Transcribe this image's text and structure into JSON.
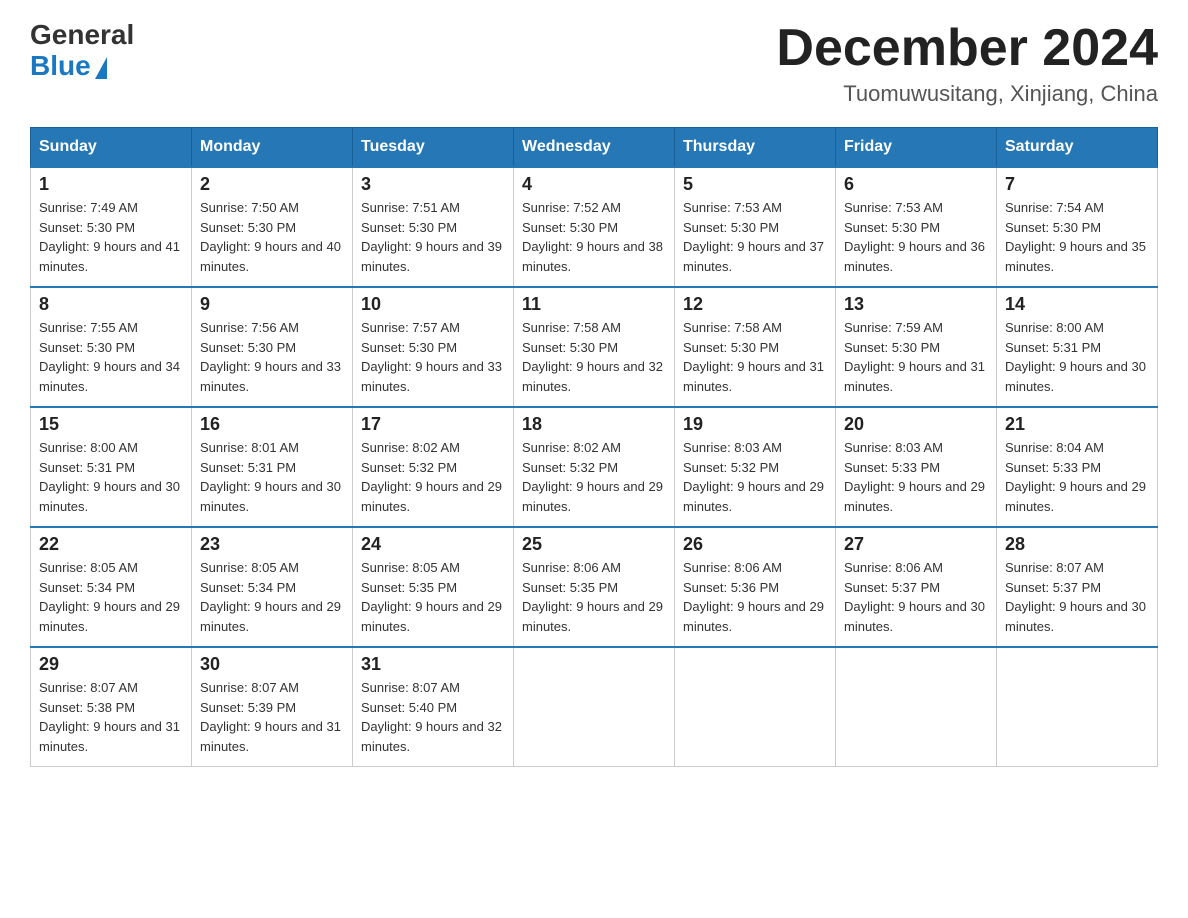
{
  "logo": {
    "general": "General",
    "blue": "Blue"
  },
  "header": {
    "title": "December 2024",
    "location": "Tuomuwusitang, Xinjiang, China"
  },
  "weekdays": [
    "Sunday",
    "Monday",
    "Tuesday",
    "Wednesday",
    "Thursday",
    "Friday",
    "Saturday"
  ],
  "weeks": [
    [
      {
        "day": "1",
        "sunrise": "7:49 AM",
        "sunset": "5:30 PM",
        "daylight": "9 hours and 41 minutes."
      },
      {
        "day": "2",
        "sunrise": "7:50 AM",
        "sunset": "5:30 PM",
        "daylight": "9 hours and 40 minutes."
      },
      {
        "day": "3",
        "sunrise": "7:51 AM",
        "sunset": "5:30 PM",
        "daylight": "9 hours and 39 minutes."
      },
      {
        "day": "4",
        "sunrise": "7:52 AM",
        "sunset": "5:30 PM",
        "daylight": "9 hours and 38 minutes."
      },
      {
        "day": "5",
        "sunrise": "7:53 AM",
        "sunset": "5:30 PM",
        "daylight": "9 hours and 37 minutes."
      },
      {
        "day": "6",
        "sunrise": "7:53 AM",
        "sunset": "5:30 PM",
        "daylight": "9 hours and 36 minutes."
      },
      {
        "day": "7",
        "sunrise": "7:54 AM",
        "sunset": "5:30 PM",
        "daylight": "9 hours and 35 minutes."
      }
    ],
    [
      {
        "day": "8",
        "sunrise": "7:55 AM",
        "sunset": "5:30 PM",
        "daylight": "9 hours and 34 minutes."
      },
      {
        "day": "9",
        "sunrise": "7:56 AM",
        "sunset": "5:30 PM",
        "daylight": "9 hours and 33 minutes."
      },
      {
        "day": "10",
        "sunrise": "7:57 AM",
        "sunset": "5:30 PM",
        "daylight": "9 hours and 33 minutes."
      },
      {
        "day": "11",
        "sunrise": "7:58 AM",
        "sunset": "5:30 PM",
        "daylight": "9 hours and 32 minutes."
      },
      {
        "day": "12",
        "sunrise": "7:58 AM",
        "sunset": "5:30 PM",
        "daylight": "9 hours and 31 minutes."
      },
      {
        "day": "13",
        "sunrise": "7:59 AM",
        "sunset": "5:30 PM",
        "daylight": "9 hours and 31 minutes."
      },
      {
        "day": "14",
        "sunrise": "8:00 AM",
        "sunset": "5:31 PM",
        "daylight": "9 hours and 30 minutes."
      }
    ],
    [
      {
        "day": "15",
        "sunrise": "8:00 AM",
        "sunset": "5:31 PM",
        "daylight": "9 hours and 30 minutes."
      },
      {
        "day": "16",
        "sunrise": "8:01 AM",
        "sunset": "5:31 PM",
        "daylight": "9 hours and 30 minutes."
      },
      {
        "day": "17",
        "sunrise": "8:02 AM",
        "sunset": "5:32 PM",
        "daylight": "9 hours and 29 minutes."
      },
      {
        "day": "18",
        "sunrise": "8:02 AM",
        "sunset": "5:32 PM",
        "daylight": "9 hours and 29 minutes."
      },
      {
        "day": "19",
        "sunrise": "8:03 AM",
        "sunset": "5:32 PM",
        "daylight": "9 hours and 29 minutes."
      },
      {
        "day": "20",
        "sunrise": "8:03 AM",
        "sunset": "5:33 PM",
        "daylight": "9 hours and 29 minutes."
      },
      {
        "day": "21",
        "sunrise": "8:04 AM",
        "sunset": "5:33 PM",
        "daylight": "9 hours and 29 minutes."
      }
    ],
    [
      {
        "day": "22",
        "sunrise": "8:05 AM",
        "sunset": "5:34 PM",
        "daylight": "9 hours and 29 minutes."
      },
      {
        "day": "23",
        "sunrise": "8:05 AM",
        "sunset": "5:34 PM",
        "daylight": "9 hours and 29 minutes."
      },
      {
        "day": "24",
        "sunrise": "8:05 AM",
        "sunset": "5:35 PM",
        "daylight": "9 hours and 29 minutes."
      },
      {
        "day": "25",
        "sunrise": "8:06 AM",
        "sunset": "5:35 PM",
        "daylight": "9 hours and 29 minutes."
      },
      {
        "day": "26",
        "sunrise": "8:06 AM",
        "sunset": "5:36 PM",
        "daylight": "9 hours and 29 minutes."
      },
      {
        "day": "27",
        "sunrise": "8:06 AM",
        "sunset": "5:37 PM",
        "daylight": "9 hours and 30 minutes."
      },
      {
        "day": "28",
        "sunrise": "8:07 AM",
        "sunset": "5:37 PM",
        "daylight": "9 hours and 30 minutes."
      }
    ],
    [
      {
        "day": "29",
        "sunrise": "8:07 AM",
        "sunset": "5:38 PM",
        "daylight": "9 hours and 31 minutes."
      },
      {
        "day": "30",
        "sunrise": "8:07 AM",
        "sunset": "5:39 PM",
        "daylight": "9 hours and 31 minutes."
      },
      {
        "day": "31",
        "sunrise": "8:07 AM",
        "sunset": "5:40 PM",
        "daylight": "9 hours and 32 minutes."
      },
      null,
      null,
      null,
      null
    ]
  ]
}
